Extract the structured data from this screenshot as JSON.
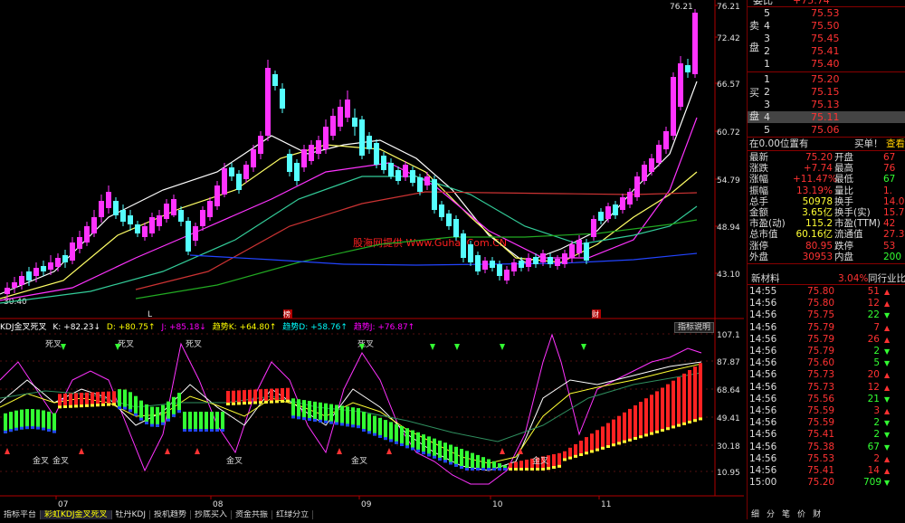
{
  "price_axis": [
    "76.21",
    "72.42",
    "66.57",
    "60.72",
    "54.79",
    "48.94",
    "43.10"
  ],
  "price_low_label": "30.40",
  "indicator_axis": [
    "107.1",
    "87.87",
    "68.64",
    "49.41",
    "30.18",
    "10.95"
  ],
  "date_axis": [
    "07",
    "08",
    "09",
    "10",
    "11"
  ],
  "markers": {
    "l": "L",
    "bang": "榜",
    "cai": "财"
  },
  "watermark": "股海网提供 Www.Guhai.Com.CN",
  "indicator_legend": {
    "name": "KDJ金叉死叉",
    "k": "K: +82.23↓",
    "d": "D: +80.75↑",
    "j": "J: +85.18↓",
    "trend_k": "趋势K: +64.80↑",
    "trend_d": "趋势D: +58.76↑",
    "trend_j": "趋势J: +76.87↑"
  },
  "explain_button": "指标说明",
  "signals": {
    "top": [
      "死叉",
      "死叉",
      "死叉",
      "死叉"
    ],
    "bottom": [
      "金叉",
      "金叉",
      "金叉",
      "金叉",
      "金叉"
    ]
  },
  "bottom_tabs": [
    "指标平台",
    "彩虹KDJ金叉死叉",
    "牡丹KDJ",
    "投机趋势",
    "抄底买入",
    "资金共振",
    "红绿分立"
  ],
  "order_book": {
    "header": {
      "label": "委比",
      "value": "+75.74"
    },
    "sell_side_label": [
      "卖",
      "盘"
    ],
    "buy_side_label": [
      "买",
      "盘"
    ],
    "sell": [
      {
        "level": "5",
        "price": "75.53"
      },
      {
        "level": "4",
        "price": "75.50"
      },
      {
        "level": "3",
        "price": "75.45"
      },
      {
        "level": "2",
        "price": "75.41"
      },
      {
        "level": "1",
        "price": "75.40"
      }
    ],
    "buy": [
      {
        "level": "1",
        "price": "75.20"
      },
      {
        "level": "2",
        "price": "75.15"
      },
      {
        "level": "3",
        "price": "75.13"
      },
      {
        "level": "4",
        "price": "75.11"
      },
      {
        "level": "5",
        "price": "75.06"
      }
    ]
  },
  "position_bar": {
    "left": "在0.00位置有",
    "mid": "买单！",
    "right": "查看i"
  },
  "quote": [
    {
      "l1": "最新",
      "v1": "75.20",
      "l2": "开盘",
      "v2": "67"
    },
    {
      "l1": "涨跌",
      "v1": "+7.74",
      "l2": "最高",
      "v2": "76"
    },
    {
      "l1": "涨幅",
      "v1": "+11.47%",
      "l2": "最低",
      "v2": "67"
    },
    {
      "l1": "振幅",
      "v1": "13.19%",
      "l2": "量比",
      "v2": "1."
    },
    {
      "l1": "总手",
      "v1": "50978",
      "l2": "换手",
      "v2": "14.0"
    },
    {
      "l1": "金额",
      "v1": "3.65亿",
      "l2": "换手(实)",
      "v2": "15.7"
    },
    {
      "l1": "市盈(动)",
      "v1": "115.2",
      "l2": "市盈(TTM)",
      "v2": "42"
    },
    {
      "l1": "总市值",
      "v1": "60.16亿",
      "l2": "流通值",
      "v2": "27.39"
    },
    {
      "l1": "涨停",
      "v1": "80.95",
      "l2": "跌停",
      "v2": "53"
    },
    {
      "l1": "外盘",
      "v1": "30953",
      "l2": "内盘",
      "v2": "200"
    }
  ],
  "industry": {
    "name": "新材料",
    "pct": "3.04%",
    "btn": "同行业比较"
  },
  "ticks": [
    {
      "t": "14:55",
      "p": "75.80",
      "v": "51",
      "d": "up"
    },
    {
      "t": "14:56",
      "p": "75.80",
      "v": "12",
      "d": "up"
    },
    {
      "t": "14:56",
      "p": "75.75",
      "v": "22",
      "d": "down"
    },
    {
      "t": "14:56",
      "p": "75.79",
      "v": "7",
      "d": "up"
    },
    {
      "t": "14:56",
      "p": "75.79",
      "v": "26",
      "d": "up"
    },
    {
      "t": "14:56",
      "p": "75.79",
      "v": "2",
      "d": "down"
    },
    {
      "t": "14:56",
      "p": "75.60",
      "v": "5",
      "d": "down"
    },
    {
      "t": "14:56",
      "p": "75.73",
      "v": "20",
      "d": "up"
    },
    {
      "t": "14:56",
      "p": "75.73",
      "v": "12",
      "d": "up"
    },
    {
      "t": "14:56",
      "p": "75.56",
      "v": "21",
      "d": "down"
    },
    {
      "t": "14:56",
      "p": "75.59",
      "v": "3",
      "d": "up"
    },
    {
      "t": "14:56",
      "p": "75.59",
      "v": "2",
      "d": "down"
    },
    {
      "t": "14:56",
      "p": "75.41",
      "v": "2",
      "d": "down"
    },
    {
      "t": "14:56",
      "p": "75.38",
      "v": "67",
      "d": "down"
    },
    {
      "t": "14:56",
      "p": "75.53",
      "v": "2",
      "d": "up"
    },
    {
      "t": "14:56",
      "p": "75.41",
      "v": "14",
      "d": "up"
    },
    {
      "t": "15:00",
      "p": "75.20",
      "v": "709",
      "d": "down"
    }
  ],
  "right_tabs": [
    "细",
    "分",
    "笔",
    "价",
    "财"
  ],
  "colors": {
    "up": "#ff3232",
    "down": "#00e600",
    "axis": "#b00000",
    "bull": "#ff33ff",
    "bear": "#55ffff"
  }
}
